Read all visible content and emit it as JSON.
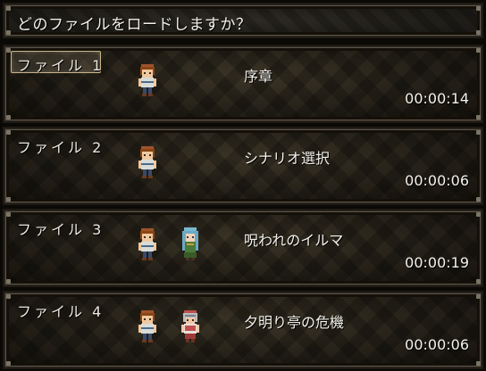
{
  "help": {
    "text": "どのファイルをロードしますか？"
  },
  "slots": [
    {
      "label": "ファイル 1",
      "title": "序章",
      "time": "00:00:14",
      "selected": true,
      "party": [
        "hero-boy-icon"
      ]
    },
    {
      "label": "ファイル 2",
      "title": "シナリオ選択",
      "time": "00:00:06",
      "selected": false,
      "party": [
        "hero-boy-icon"
      ]
    },
    {
      "label": "ファイル 3",
      "title": "呪われのイルマ",
      "time": "00:00:19",
      "selected": false,
      "party": [
        "hero-boy-icon",
        "blue-haired-girl-icon"
      ]
    },
    {
      "label": "ファイル 4",
      "title": "夕明り亭の危機",
      "time": "00:00:06",
      "selected": false,
      "party": [
        "hero-boy-icon",
        "helmet-girl-icon"
      ]
    }
  ],
  "colors": {
    "cursor": "#c8b48a",
    "text": "#f4f1ea",
    "window": "#2a261d"
  }
}
